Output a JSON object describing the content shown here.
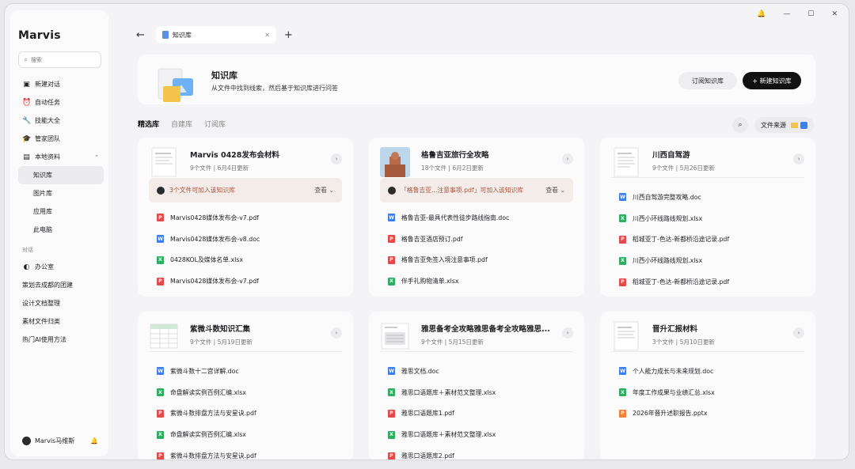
{
  "brand": "Marvis",
  "search_placeholder": "搜索",
  "nav": {
    "new_chat": "新建对话",
    "auto_task": "自动任务",
    "skills": "技能大全",
    "team": "管家团队",
    "local": "本地资料",
    "sub": [
      "知识库",
      "图片库",
      "应用库",
      "此电脑"
    ],
    "chat_section": "对话",
    "chats": [
      "办公室",
      "策划去成都的团建",
      "设计文档整理",
      "素材文件归类",
      "热门AI使用方法"
    ]
  },
  "user": {
    "name": "Marvis马维斯"
  },
  "tab": {
    "label": "知识库"
  },
  "hero": {
    "title": "知识库",
    "subtitle": "从文件中找到线索，然后基于知识库进行问答",
    "subscribe": "订阅知识库",
    "create": "+ 新建知识库"
  },
  "subtabs": [
    "精选库",
    "自建库",
    "订阅库"
  ],
  "source_label": "文件来源",
  "more_label": "查看",
  "cards": [
    {
      "title": "Marvis 0428发布会材料",
      "count": "9个文件",
      "date": "6月4日更新",
      "notice": "3个文件可加入该知识库",
      "files": [
        {
          "name": "Marvis0428媒体发布会-v7.pdf",
          "type": "pdf"
        },
        {
          "name": "Marvis0428媒体发布会-v8.doc",
          "type": "doc"
        },
        {
          "name": "0428KOL及媒体名单.xlsx",
          "type": "xlsx"
        },
        {
          "name": "Marvis0428媒体发布会-v7.pdf",
          "type": "pdf"
        }
      ]
    },
    {
      "title": "格鲁吉亚旅行全攻略",
      "count": "18个文件",
      "date": "6月2日更新",
      "notice": "「格鲁吉亚...注意事项.pdf」可加入该知识库",
      "files": [
        {
          "name": "格鲁吉亚-最具代表性徒步路线指南.doc",
          "type": "doc"
        },
        {
          "name": "格鲁吉亚酒店预订.pdf",
          "type": "pdf"
        },
        {
          "name": "格鲁吉亚免签入境注意事项.pdf",
          "type": "pdf"
        },
        {
          "name": "伴手礼购物清单.xlsx",
          "type": "xlsx"
        }
      ]
    },
    {
      "title": "川西自驾游",
      "count": "9个文件",
      "date": "5月26日更新",
      "files": [
        {
          "name": "川西自驾游完整攻略.doc",
          "type": "doc"
        },
        {
          "name": "川西小环线路线规划.xlsx",
          "type": "xlsx"
        },
        {
          "name": "稻城亚丁-色达-新都桥沿途记录.pdf",
          "type": "pdf"
        },
        {
          "name": "川西小环线路线规划.xlsx",
          "type": "xlsx"
        },
        {
          "name": "稻城亚丁-色达-新都桥沿途记录.pdf",
          "type": "pdf"
        }
      ]
    },
    {
      "title": "紫微斗数知识汇集",
      "count": "9个文件",
      "date": "5月19日更新",
      "files": [
        {
          "name": "紫微斗数十二宫详解.doc",
          "type": "doc"
        },
        {
          "name": "命盘解读实例百例汇编.xlsx",
          "type": "xlsx"
        },
        {
          "name": "紫微斗数排盘方法与安星诀.pdf",
          "type": "pdf"
        },
        {
          "name": "命盘解读实例百例汇编.xlsx",
          "type": "xlsx"
        },
        {
          "name": "紫微斗数排盘方法与安星诀.pdf",
          "type": "pdf"
        }
      ]
    },
    {
      "title": "雅思备考全攻略雅思备考全攻略雅思...",
      "count": "9个文件",
      "date": "5月15日更新",
      "files": [
        {
          "name": "雅思文档.doc",
          "type": "doc"
        },
        {
          "name": "雅思口语题库＋素材范文整理.xlsx",
          "type": "xlsx"
        },
        {
          "name": "雅思口语题库1.pdf",
          "type": "pdf"
        },
        {
          "name": "雅思口语题库＋素材范文整理.xlsx",
          "type": "xlsx"
        },
        {
          "name": "雅思口语题库2.pdf",
          "type": "pdf"
        }
      ]
    },
    {
      "title": "晋升汇报材料",
      "count": "3个文件",
      "date": "5月10日更新",
      "files": [
        {
          "name": "个人能力成长与未来规划.doc",
          "type": "doc"
        },
        {
          "name": "年度工作成果与业绩汇总.xlsx",
          "type": "xlsx"
        },
        {
          "name": "2026年晋升述职报告.pptx",
          "type": "pptx"
        }
      ]
    }
  ]
}
